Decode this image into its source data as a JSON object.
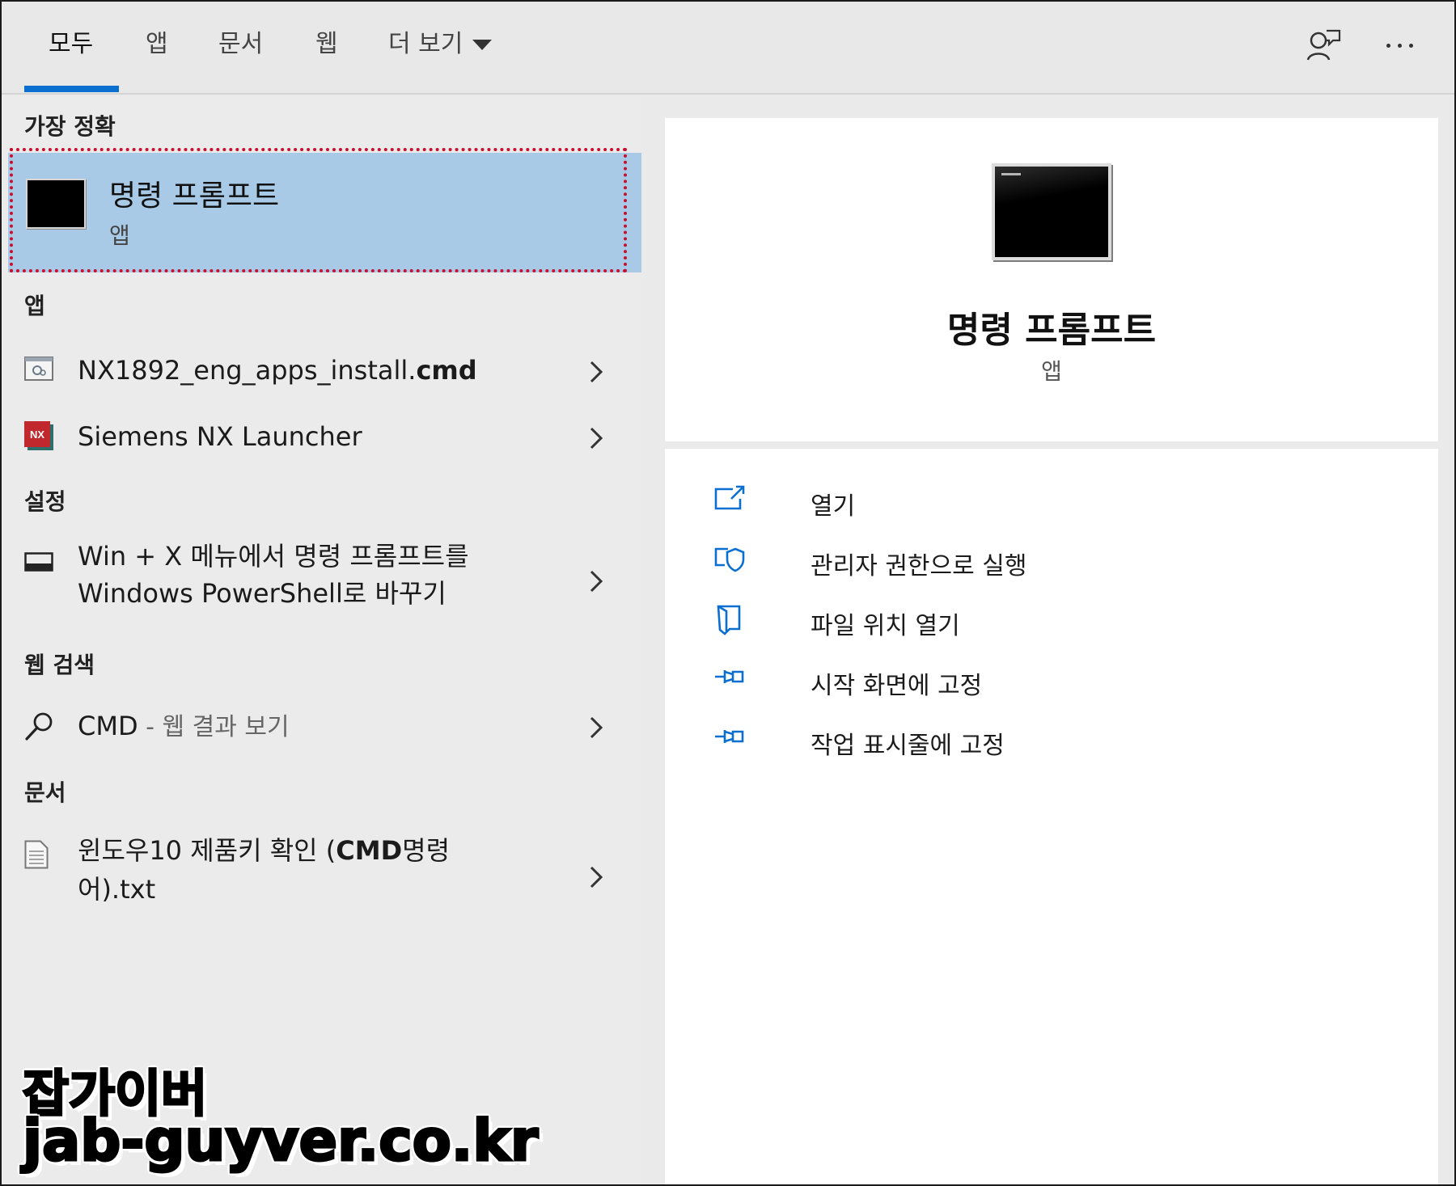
{
  "tabs": [
    {
      "label": "모두",
      "active": true
    },
    {
      "label": "앱"
    },
    {
      "label": "문서"
    },
    {
      "label": "웹"
    },
    {
      "label": "더 보기"
    }
  ],
  "top_icons": {
    "feedback": "feedback-person-icon",
    "more": "more-ellipsis-icon"
  },
  "accent_color": "#0a6fd1",
  "selection_color": "#a8cae6",
  "best_match": {
    "heading": "가장 정확",
    "title": "명령 프롬프트",
    "subtitle": "앱",
    "icon": "command-prompt-icon"
  },
  "apps_section": {
    "heading": "앱",
    "items": [
      {
        "label_prefix": "NX1892_eng_apps_install.",
        "label_bold": "cmd",
        "icon": "cmd-script-icon"
      },
      {
        "label": "Siemens NX Launcher",
        "icon": "nx-logo-icon",
        "icon_text": "NX"
      }
    ]
  },
  "settings_section": {
    "heading": "설정",
    "items": [
      {
        "line1": "Win + X 메뉴에서 명령 프롬프트를",
        "line2": "Windows PowerShell로 바꾸기",
        "icon": "taskbar-icon"
      }
    ]
  },
  "web_section": {
    "heading": "웹 검색",
    "items": [
      {
        "label": "CMD",
        "suffix": " - 웹 결과 보기",
        "icon": "search-icon"
      }
    ]
  },
  "docs_section": {
    "heading": "문서",
    "items": [
      {
        "line1_prefix": "윈도우10 제품키 확인 (",
        "line1_bold": "CMD",
        "line1_suffix": "명령",
        "line2": "어).txt",
        "icon": "text-document-icon"
      }
    ]
  },
  "detail": {
    "title": "명령 프롬프트",
    "subtitle": "앱",
    "actions": [
      {
        "label": "열기",
        "icon": "open-icon"
      },
      {
        "label": "관리자 권한으로 실행",
        "icon": "admin-shield-icon"
      },
      {
        "label": "파일 위치 열기",
        "icon": "folder-location-icon"
      },
      {
        "label": "시작 화면에 고정",
        "icon": "pin-icon"
      },
      {
        "label": "작업 표시줄에 고정",
        "icon": "pin-icon"
      }
    ]
  },
  "watermark": {
    "line1": "잡가이버",
    "line2": "jab-guyver.co.kr"
  }
}
